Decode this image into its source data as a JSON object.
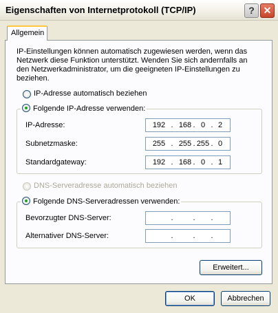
{
  "window": {
    "title": "Eigenschaften von Internetprotokoll (TCP/IP)",
    "help_symbol": "?",
    "close_symbol": "✕"
  },
  "tabs": [
    {
      "label": "Allgemein"
    }
  ],
  "intro_text": "IP-Einstellungen können automatisch zugewiesen werden, wenn das Netzwerk diese Funktion unterstützt. Wenden Sie sich andernfalls an den Netzwerkadministrator, um die geeigneten IP-Einstellungen zu beziehen.",
  "ip_section": {
    "auto_label": "IP-Adresse automatisch beziehen",
    "manual_label": "Folgende IP-Adresse verwenden:",
    "selected": "manual",
    "fields": [
      {
        "label": "IP-Adresse:",
        "octets": [
          "192",
          "168",
          "0",
          "2"
        ]
      },
      {
        "label": "Subnetzmaske:",
        "octets": [
          "255",
          "255",
          "255",
          "0"
        ]
      },
      {
        "label": "Standardgateway:",
        "octets": [
          "192",
          "168",
          "0",
          "1"
        ]
      }
    ]
  },
  "dns_section": {
    "auto_label": "DNS-Serveradresse automatisch beziehen",
    "auto_disabled": true,
    "manual_label": "Folgende DNS-Serveradressen verwenden:",
    "selected": "manual",
    "fields": [
      {
        "label": "Bevorzugter DNS-Server:",
        "octets": [
          "",
          "",
          "",
          ""
        ]
      },
      {
        "label": "Alternativer DNS-Server:",
        "octets": [
          "",
          "",
          "",
          ""
        ]
      }
    ]
  },
  "buttons": {
    "advanced": "Erweitert...",
    "ok": "OK",
    "cancel": "Abbrechen"
  },
  "ip_separator": "."
}
